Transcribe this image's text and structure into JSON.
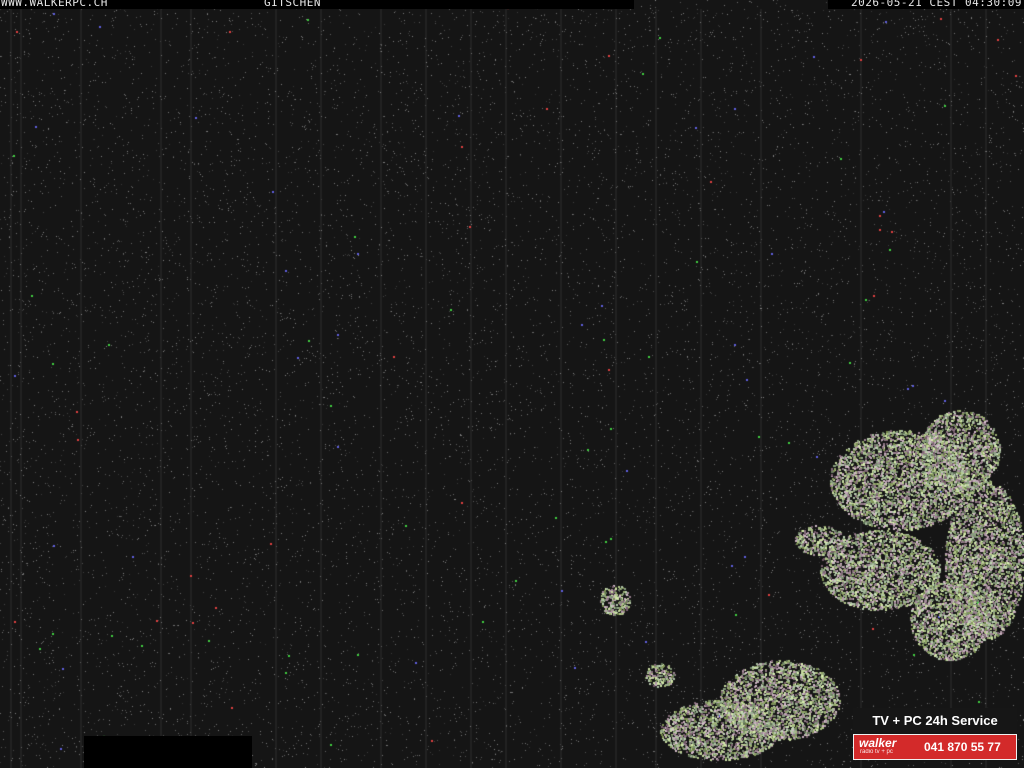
{
  "overlay": {
    "site": "WWW.WALKERPC.CH",
    "location": "GITSCHEN",
    "timestamp": "2026-05-21 CEST 04:30:09"
  },
  "ad": {
    "service": "TV + PC 24h Service",
    "brand": "walker",
    "tagline": "radio tv + pc",
    "phone": "041 870 55 77",
    "colors": {
      "red": "#d32a2a",
      "dark": "#161616"
    }
  },
  "scene": {
    "background": "#151515",
    "foliage": "#8a9a6a"
  }
}
